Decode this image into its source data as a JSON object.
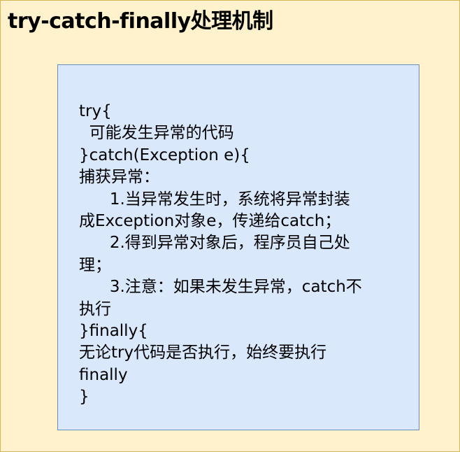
{
  "title": "try-catch-finally处理机制",
  "box_lines": [
    "try{",
    "  可能发生异常的代码",
    "}catch(Exception e){",
    "捕获异常：",
    "      1.当异常发生时，系统将异常封装",
    "成Exception对象e，传递给catch；",
    "      2.得到异常对象后，程序员自己处",
    "理；",
    "      3.注意：如果未发生异常，catch不",
    "执行",
    "}finally{",
    "无论try代码是否执行，始终要执行",
    "finally",
    "}"
  ],
  "colors": {
    "outer_fill": "#fff2cc",
    "outer_border": "#d6b656",
    "inner_fill": "#dae8fc",
    "inner_border": "#6c8ebf"
  }
}
